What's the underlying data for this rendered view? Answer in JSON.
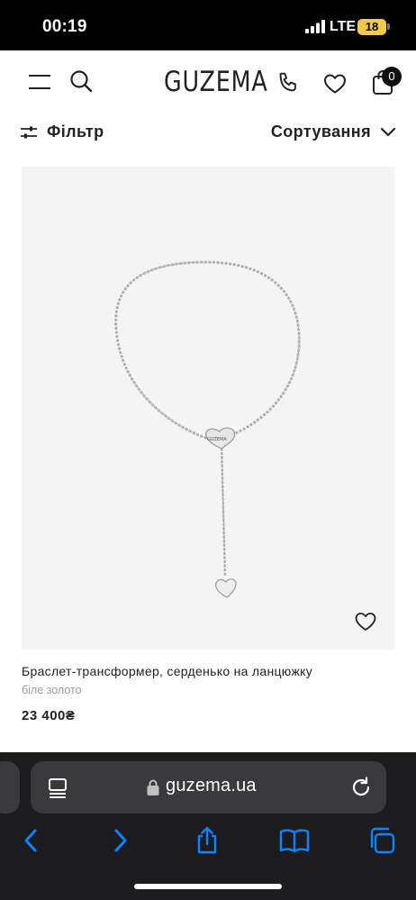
{
  "status_bar": {
    "time": "00:19",
    "network": "LTE",
    "battery": "18"
  },
  "header": {
    "logo": "GUZEMA",
    "cart_count": "0"
  },
  "filter_bar": {
    "filter_label": "Фільтр",
    "sort_label": "Сортування"
  },
  "product": {
    "image_brand_text": "GUZEMA",
    "title": "Браслет-трансформер, серденько на ланцюжку",
    "material": "біле золото",
    "price": "23 400₴"
  },
  "browser": {
    "url": "guzema.ua"
  },
  "icons": {
    "menu": "menu-icon",
    "search": "search-icon",
    "phone": "phone-icon",
    "favorites": "heart-icon",
    "cart": "bag-icon",
    "filter": "sliders-icon",
    "sort": "chevron-down-icon",
    "lock": "lock-icon",
    "reload": "reload-icon",
    "back": "chevron-left-icon",
    "forward": "chevron-right-icon",
    "share": "share-icon",
    "bookmarks": "book-icon",
    "tabs": "tabs-icon"
  },
  "colors": {
    "accent_ios": "#0a84ff",
    "battery": "#f2c94c",
    "image_bg": "#f4f4f4"
  }
}
